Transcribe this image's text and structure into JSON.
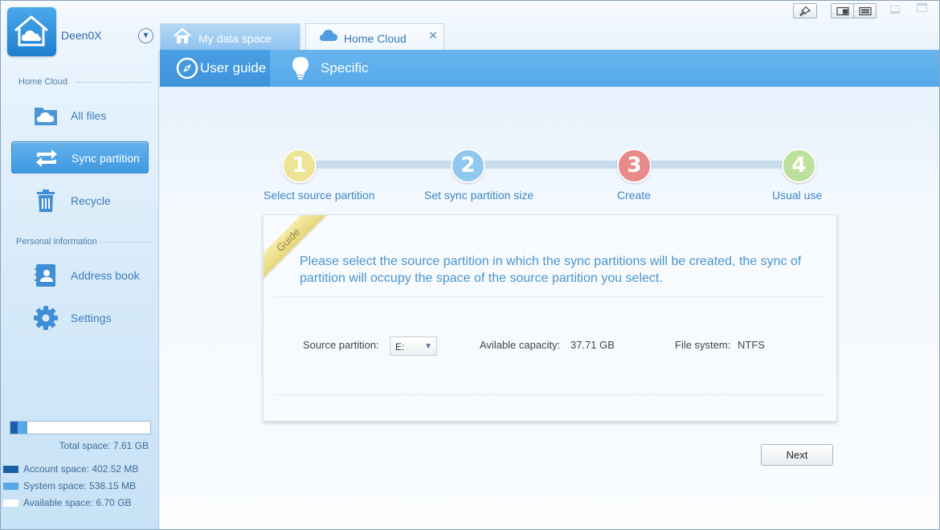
{
  "app": {
    "username": "Deen0X",
    "user_menu_arrow": "▼"
  },
  "tabs": [
    {
      "label": "My data space",
      "icon": "home-icon",
      "active": false
    },
    {
      "label": "Home Cloud",
      "icon": "cloud-icon",
      "active": true,
      "close": "✕"
    }
  ],
  "window_buttons": [
    "pin-icon",
    "mini-mode-icon",
    "compact-mode-icon",
    "minimize-icon",
    "restore-icon"
  ],
  "sidebar": {
    "section_home": "Home Cloud",
    "section_personal": "Personal information",
    "items": [
      {
        "label": "All files",
        "icon": "folder-cloud-icon",
        "active": false
      },
      {
        "label": "Sync partition",
        "icon": "sync-icon",
        "active": true
      },
      {
        "label": "Recycle",
        "icon": "trash-icon",
        "active": false
      },
      {
        "label": "Address book",
        "icon": "address-book-icon",
        "active": false
      },
      {
        "label": "Settings",
        "icon": "gear-icon",
        "active": false
      }
    ],
    "storage": {
      "account_fraction": 0.053,
      "system_fraction": 0.071,
      "total": "Total space: 7.61 GB",
      "account": "Account space: 402.52 MB",
      "system": "System space: 538.15 MB",
      "available": "Available space: 6.70 GB",
      "colors": {
        "account": "#1a5fa8",
        "system": "#57a8e6",
        "available": "#ffffff"
      }
    }
  },
  "subnav": {
    "tabs": [
      {
        "label": "User guide",
        "icon": "compass-icon",
        "active": true
      },
      {
        "label": "Specific",
        "icon": "lightbulb-icon",
        "active": false
      }
    ]
  },
  "steps": [
    {
      "number": "1",
      "label": "Select source partition",
      "color": "#ece496"
    },
    {
      "number": "2",
      "label": "Set sync partition size",
      "color": "#91c8ef"
    },
    {
      "number": "3",
      "label": "Create",
      "color": "#e98a8a"
    },
    {
      "number": "4",
      "label": "Usual use",
      "color": "#bde09c"
    }
  ],
  "guide": {
    "ribbon": "Guide",
    "message": "Please select the source partition in which the sync partitions will be created, the sync of partition will occupy the space of the source partition you select.",
    "source_label": "Source partition:",
    "source_value": "E:",
    "capacity_label": "Avilable capacity:",
    "capacity_value": "37.71 GB",
    "fs_label": "File system:",
    "fs_value": "NTFS"
  },
  "buttons": {
    "next": "Next"
  }
}
